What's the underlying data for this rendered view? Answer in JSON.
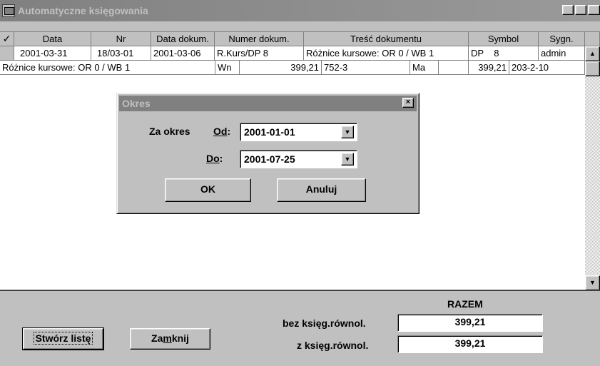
{
  "window": {
    "title": "Automatyczne księgowania"
  },
  "grid": {
    "headers": [
      "Data",
      "Nr",
      "Data dokum.",
      "Numer dokum.",
      "Treść dokumentu",
      "Symbol",
      "Sygn."
    ],
    "row1": [
      "2001-03-31",
      "18/03-01",
      "2001-03-06",
      "R.Kurs/DP 8",
      "Różnice kursowe: OR 0 / WB 1",
      "DP    8",
      "admin"
    ],
    "row2": {
      "desc": "Różnice kursowe: OR 0 / WB 1",
      "wn_label": "Wn",
      "wn_amount": "399,21",
      "wn_account": "752-3",
      "ma_label": "Ma",
      "ma_amount": "399,21",
      "ma_account": "203-2-10"
    }
  },
  "dialog": {
    "title": "Okres",
    "za_okres": "Za okres",
    "od_label": "Od",
    "do_label": "Do",
    "od_value": "2001-01-01",
    "do_value": "2001-07-25",
    "ok_label": "OK",
    "cancel_label": "Anuluj"
  },
  "footer": {
    "razem": "RAZEM",
    "bez_label": "bez księg.równol.",
    "bez_value": "399,21",
    "z_label": "z księg.równol.",
    "z_value": "399,21",
    "create_list": "Stwórz listę",
    "close_prefix": "Za",
    "close_u": "m",
    "close_suffix": "knij"
  }
}
